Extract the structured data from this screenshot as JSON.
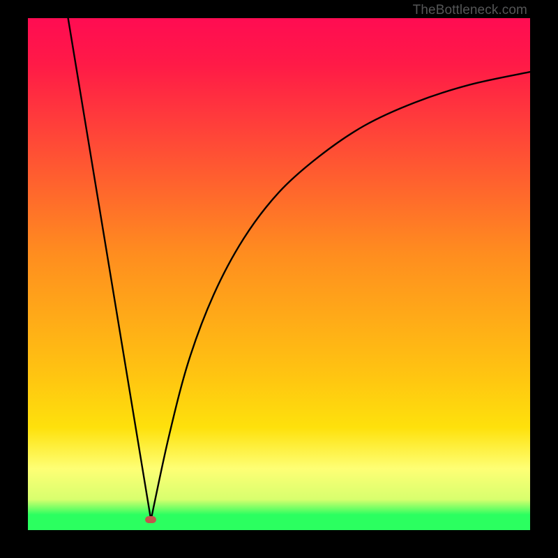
{
  "watermark": "TheBottleneck.com",
  "colors": {
    "top": "#ff0c52",
    "top2": "#ff1a47",
    "mid1": "#ff8d1f",
    "mid2": "#ffc511",
    "band_start": "#fee10c",
    "band_mid": "#feff75",
    "band_end": "#d8ff6e",
    "green": "#2bff60",
    "curve": "#000000",
    "marker": "#c1564c",
    "frame": "#000000"
  },
  "chart_data": {
    "type": "line",
    "title": "",
    "xlabel": "",
    "ylabel": "",
    "xlim": [
      0,
      100
    ],
    "ylim": [
      0,
      100
    ],
    "series": [
      {
        "name": "left-segment",
        "x": [
          8,
          24.5
        ],
        "y": [
          100,
          2
        ]
      },
      {
        "name": "right-segment",
        "x": [
          24.5,
          28,
          32,
          37,
          43,
          50,
          58,
          67,
          77,
          88,
          100
        ],
        "y": [
          2,
          18,
          33,
          46,
          57,
          66,
          73,
          79,
          83.5,
          87,
          89.5
        ]
      }
    ],
    "marker": {
      "x": 24.5,
      "y": 2
    },
    "annotations": []
  }
}
